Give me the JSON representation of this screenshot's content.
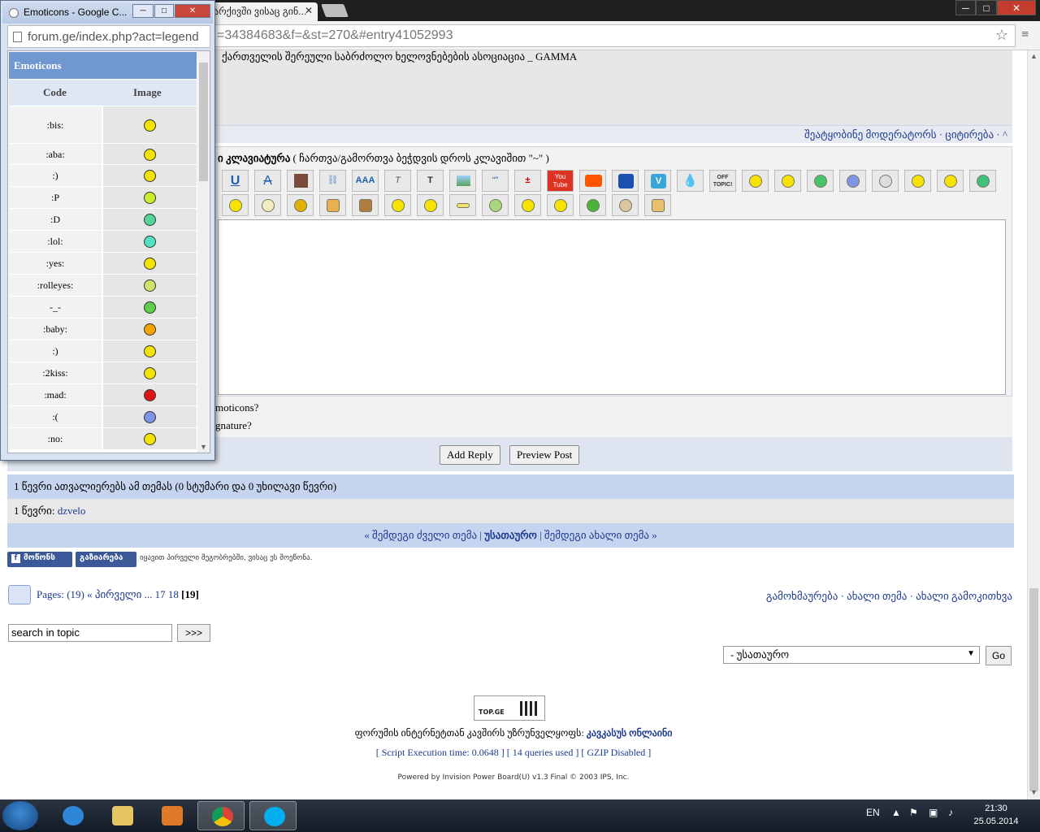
{
  "browser": {
    "tabs": [
      {
        "title": "Emoticons - Google C..."
      },
      {
        "title": "არქივში ვისაც გინ..."
      }
    ],
    "url_fragment": "=34384683&f=&st=270&#entry41052993",
    "window_buttons": {
      "minimize": "─",
      "maximize": "□",
      "close": "✕"
    }
  },
  "popup": {
    "title": "Emoticons - Google C...",
    "url": "forum.ge/index.php?act=legend",
    "header": "Emoticons",
    "col_code": "Code",
    "col_image": "Image",
    "rows": [
      {
        "code": ":bis:",
        "color": "#f2e400"
      },
      {
        "code": ":aba:",
        "color": "#f2e400"
      },
      {
        "code": ":)",
        "color": "#f2e400"
      },
      {
        "code": ":P",
        "color": "#c8ef2b"
      },
      {
        "code": ":D",
        "color": "#56d59a"
      },
      {
        "code": ":lol:",
        "color": "#4fe3c4"
      },
      {
        "code": ":yes:",
        "color": "#f2e400"
      },
      {
        "code": ":rolleyes:",
        "color": "#cde56a"
      },
      {
        "code": "-_-",
        "color": "#5ecf4a"
      },
      {
        "code": ":baby:",
        "color": "#f4a600"
      },
      {
        "code": ":)",
        "color": "#f2e400"
      },
      {
        "code": ":2kiss:",
        "color": "#f2e400"
      },
      {
        "code": ":mad:",
        "color": "#e01414"
      },
      {
        "code": ":(",
        "color": "#7f94e6"
      },
      {
        "code": ":no:",
        "color": "#f2e400"
      }
    ]
  },
  "post": {
    "signature": "ქართველის შერეული საბრძოლო ხელოვნებების ასოციაცია _ GAMMA",
    "mod_links": "შეატყობინე მოდერატორს · ციტირება · ^"
  },
  "editor": {
    "keyboard_bold": "ი კლავიატურა",
    "keyboard_hint": "( ჩართვა/გამორთვა ბეჭდვის დროს კლავიშით \"~\" )",
    "toolbar_row1": [
      "U",
      "A",
      "",
      "",
      "AAA",
      "T",
      "T",
      "",
      "",
      "",
      "You Tube",
      "",
      "",
      "V",
      "",
      "OFF TOPIC!",
      "",
      "",
      "",
      "",
      "",
      "",
      "",
      ""
    ],
    "opt_emoticons": "moticons?",
    "opt_signature": "gnature?",
    "add_reply": "Add Reply",
    "preview_post": "Preview Post"
  },
  "info": {
    "readers": "1 წევრი ათვალიერებს ამ თემას (0 სტუმარი და 0 უხილავი წევრი)",
    "members_label": "1 წევრი:",
    "member_name": "dzvelo"
  },
  "nav": {
    "prev": "« შემდეგი ძველი თემა",
    "index": "უსათაურო",
    "next": "შემდეგი ახალი თემა »"
  },
  "facebook": {
    "like": "მოწონს",
    "share": "გაზიარება",
    "text": "იყავით პირველი მეგობრებში, ვისაც ეს მოეწონა."
  },
  "pagination": {
    "label": "Pages: (19) « პირველი ... 17 18",
    "current": "[19]",
    "right_links": "გამოხმაურება · ახალი თემა · ახალი გამოკითხვა"
  },
  "search": {
    "value": "search in topic",
    "button": ">>>"
  },
  "jump": {
    "selected": "- უსათაურო",
    "go": "Go"
  },
  "footer": {
    "badge": "TOP.GE",
    "provider_prefix": "ფორუმის ინტერნეტთან კავშირს უზრუნველყოფს:",
    "provider_name": "კავკასუს ონლაინი",
    "stats": "[ Script Execution time: 0.0648 ]   [ 14 queries used ]   [ GZIP Disabled ]",
    "powered": "Powered by Invision Power Board(U) v1.3 Final © 2003  IPS, Inc."
  },
  "taskbar": {
    "lang": "EN",
    "time": "21:30",
    "date": "25.05.2014"
  }
}
